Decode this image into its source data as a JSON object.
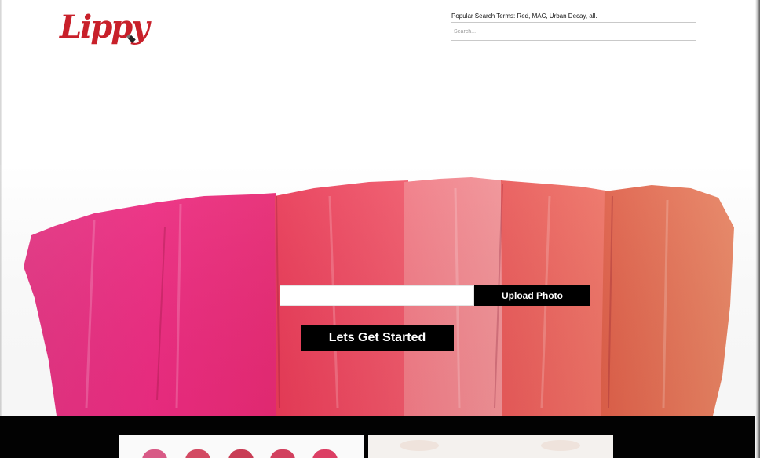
{
  "logo": {
    "text": "Lippy",
    "icon": "lipstick-icon",
    "color": "#c8202a"
  },
  "search": {
    "popular_terms": "Popular Search Terms: Red, MAC, Urban Decay, all.",
    "placeholder": "Search..."
  },
  "hero": {
    "upload_label": "Upload Photo",
    "start_label": "Lets Get Started",
    "swatch_colors": [
      "#e9237a",
      "#ef4a5c",
      "#f1858f",
      "#ee6b61",
      "#e2744f"
    ]
  },
  "featured": {
    "cards": [
      "lipsticks-image",
      "face-image"
    ],
    "lipstick_colors": [
      "#d85a86",
      "#d34a63",
      "#c93d55",
      "#d2405e",
      "#dc3f64"
    ]
  }
}
